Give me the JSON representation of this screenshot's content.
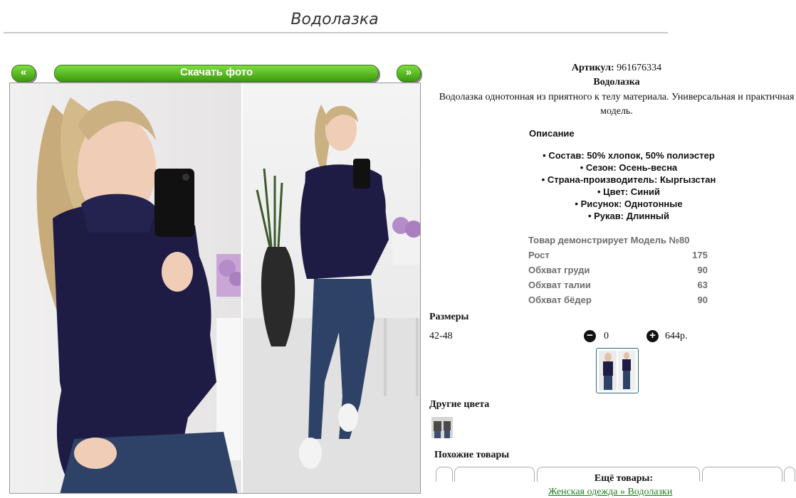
{
  "page": {
    "title": "Водолазка"
  },
  "gallery": {
    "prev_label": "«",
    "next_label": "»",
    "download_label": "Скачать фото"
  },
  "product": {
    "article_label": "Артикул:",
    "article_value": "961676334",
    "name": "Водолазка",
    "description": "Водолазка однотонная из приятного к телу материала. Универсальная и практичная модель.",
    "desc_heading": "Описание",
    "features": [
      "Состав: 50% хлопок, 50% полиэстер",
      "Сезон: Осень-весна",
      "Страна-производитель: Кыргызстан",
      "Цвет: Синий",
      "Рисунок: Однотонные",
      "Рукав: Длинный"
    ]
  },
  "model": {
    "heading": "Товар демонстрирует Модель №80",
    "rows": [
      {
        "label": "Рост",
        "value": "175"
      },
      {
        "label": "Обхват груди",
        "value": "90"
      },
      {
        "label": "Обхват талии",
        "value": "63"
      },
      {
        "label": "Обхват бёдер",
        "value": "90"
      }
    ]
  },
  "order": {
    "sizes_heading": "Размеры",
    "size": "42-48",
    "minus_icon": "minus-circle-icon",
    "plus_icon": "plus-circle-icon",
    "quantity": "0",
    "price": "644р."
  },
  "other_colors": {
    "heading": "Другие цвета"
  },
  "similar": {
    "heading": "Похожие товары"
  },
  "more": {
    "heading": "Ещё товары:",
    "breadcrumb": "Женская одежда » Водолазки"
  },
  "colors": {
    "button_green": "#4cae1c",
    "sweater_navy": "#1e1c44",
    "jeans_blue": "#2e4166",
    "link_green": "#1e7f1e"
  }
}
